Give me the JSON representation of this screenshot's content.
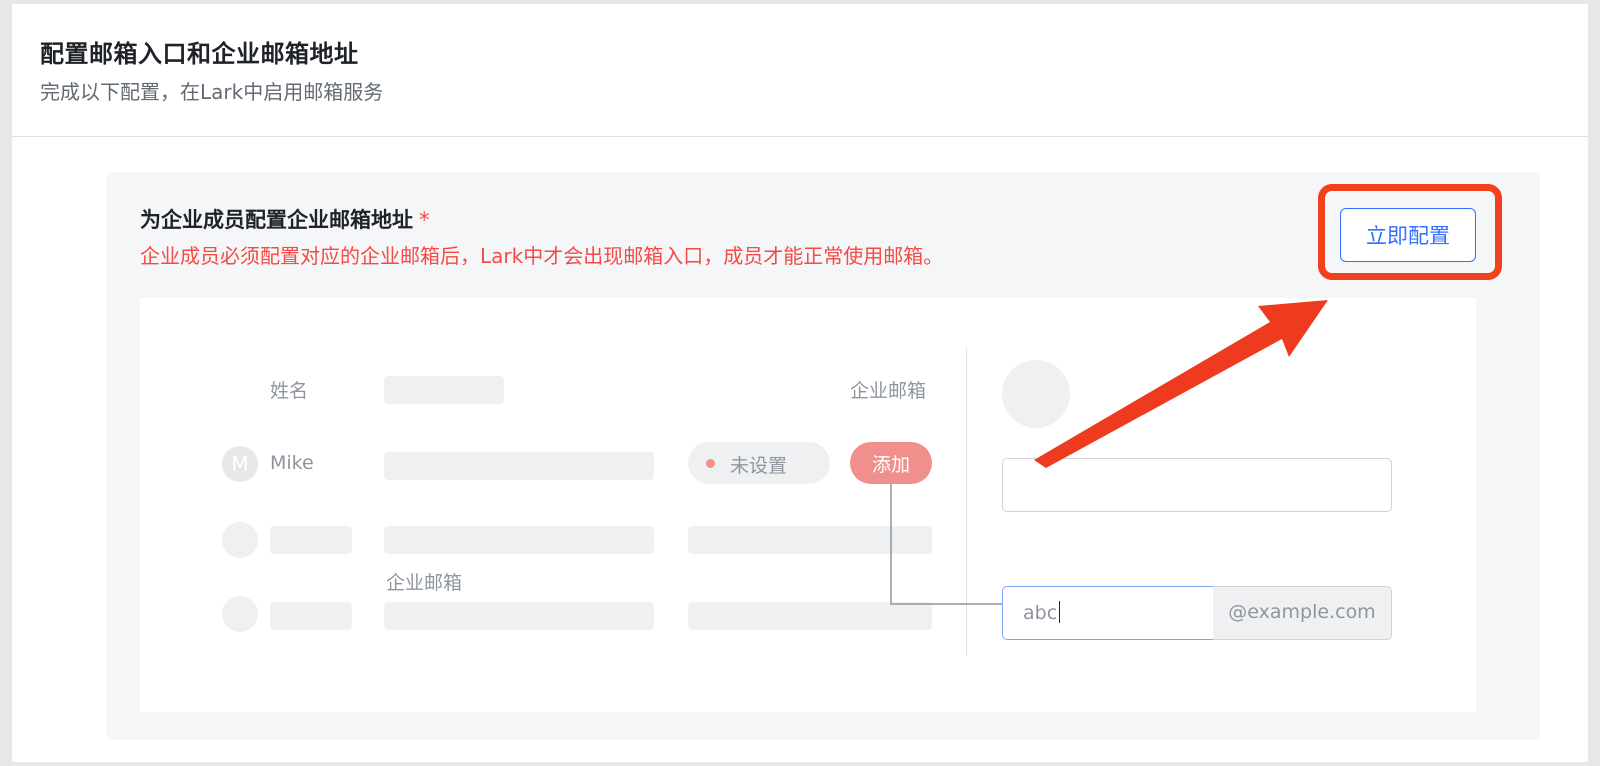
{
  "header": {
    "title": "配置邮箱入口和企业邮箱地址",
    "subtitle": "完成以下配置，在Lark中启用邮箱服务"
  },
  "section": {
    "title": "为企业成员配置企业邮箱地址",
    "required_mark": "*",
    "warning": "企业成员必须配置对应的企业邮箱后，Lark中才会出现邮箱入口，成员才能正常使用邮箱。",
    "button_label": "立即配置"
  },
  "illustration": {
    "col_name": "姓名",
    "col_email": "企业邮箱",
    "member_initial": "M",
    "member_name": "Mike",
    "status": "未设置",
    "add_label": "添加",
    "email_label": "企业邮箱",
    "email_value": "abc",
    "email_domain": "@example.com"
  },
  "colors": {
    "accent": "#3370ff",
    "warning": "#f54a45",
    "highlight": "#f0401e"
  }
}
